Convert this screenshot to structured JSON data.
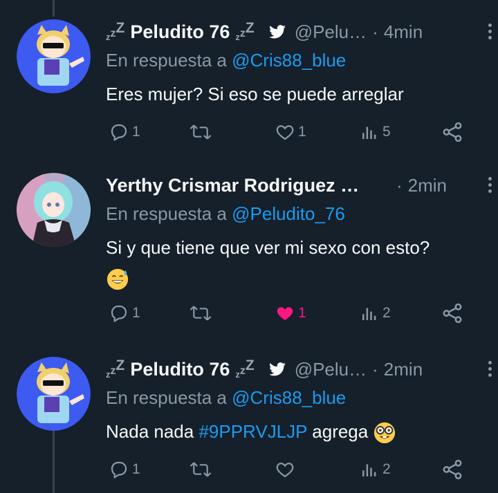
{
  "tweets": [
    {
      "name": "Peludito 76",
      "handle": "@Pelu…",
      "time": "4min",
      "reply_prefix": "En respuesta a",
      "reply_mention": "@Cris88_blue",
      "text": "Eres mujer? Si eso se puede arreglar",
      "replies": "1",
      "retweets": "",
      "likes": "1",
      "views": "5",
      "liked": false
    },
    {
      "name": "Yerthy Crismar Rodriguez …",
      "handle": "",
      "time": "2min",
      "reply_prefix": "En respuesta a",
      "reply_mention": "@Peludito_76",
      "text": "Si y que tiene que ver mi sexo con esto?",
      "emoji": "sweat-smile-emoji",
      "replies": "1",
      "retweets": "",
      "likes": "1",
      "views": "2",
      "liked": true
    },
    {
      "name": "Peludito 76",
      "handle": "@Pelu…",
      "time": "2min",
      "reply_prefix": "En respuesta a",
      "reply_mention": "@Cris88_blue",
      "text_before": "Nada nada ",
      "hashtag": "#9PPRVJLJP",
      "text_after": " agrega",
      "emoji": "nerd-face-emoji",
      "replies": "1",
      "retweets": "",
      "likes": "",
      "views": "2",
      "liked": false
    }
  ],
  "colors": {
    "background": "#15202b",
    "primary_text": "#f7f9f9",
    "secondary_text": "#8b98a5",
    "link": "#1d9bf0",
    "like": "#f91880"
  }
}
